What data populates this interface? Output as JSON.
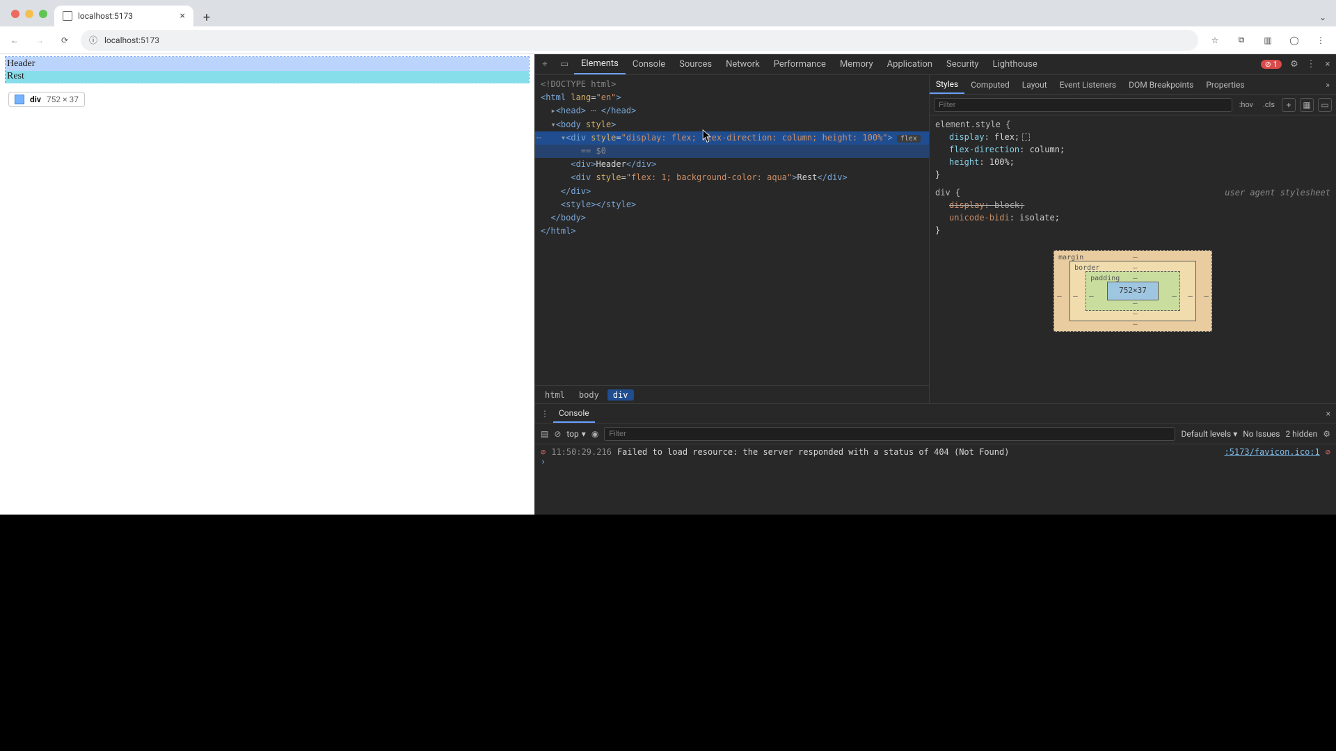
{
  "browser": {
    "tab_title": "localhost:5173",
    "url": "localhost:5173",
    "traffic_colors": [
      "#ed6a5e",
      "#f5bf4f",
      "#61c554"
    ]
  },
  "page": {
    "header_text": "Header",
    "rest_text": "Rest",
    "tooltip_tag": "div",
    "tooltip_dims": "752 × 37"
  },
  "devtools": {
    "tabs": [
      "Elements",
      "Console",
      "Sources",
      "Network",
      "Performance",
      "Memory",
      "Application",
      "Security",
      "Lighthouse"
    ],
    "active_tab": "Elements",
    "error_count": "1",
    "dom": {
      "doctype": "<!DOCTYPE html>",
      "html_open": "<html lang=\"en\">",
      "head": "<head> ··· </head>",
      "body_open": "<body style>",
      "selected_div": "<div style=\"display: flex; flex-direction: column; height: 100%\">",
      "eq0": "== $0",
      "header_div": "<div>Header</div>",
      "rest_div": "<div style=\"flex: 1; background-color: aqua\">Rest</div>",
      "div_close": "</div>",
      "style_tag": "<style></style>",
      "body_close": "</body>",
      "html_close": "</html>",
      "flex_badge": "flex"
    },
    "breadcrumbs": [
      "html",
      "body",
      "div"
    ],
    "styles": {
      "tabs": [
        "Styles",
        "Computed",
        "Layout",
        "Event Listeners",
        "DOM Breakpoints",
        "Properties"
      ],
      "filter_placeholder": "Filter",
      "hov": ":hov",
      "cls": ".cls",
      "element_style_label": "element.style {",
      "props": [
        {
          "n": "display",
          "v": "flex;"
        },
        {
          "n": "flex-direction",
          "v": "column;"
        },
        {
          "n": "height",
          "v": "100%;"
        }
      ],
      "div_rule_label": "div {",
      "agent": "user agent stylesheet",
      "div_props": [
        {
          "n": "display",
          "v": "block;",
          "strike": true
        },
        {
          "n": "unicode-bidi",
          "v": "isolate;"
        }
      ]
    },
    "boxmodel": {
      "margin": "margin",
      "border": "border",
      "padding": "padding",
      "content": "752×37"
    }
  },
  "console": {
    "drawer_tab": "Console",
    "context": "top",
    "filter_placeholder": "Filter",
    "levels": "Default levels",
    "issues": "No Issues",
    "hidden": "2 hidden",
    "log": {
      "ts": "11:50:29.216",
      "msg": "Failed to load resource: the server responded with a status of 404 (Not Found)",
      "src": ":5173/favicon.ico:1"
    }
  }
}
